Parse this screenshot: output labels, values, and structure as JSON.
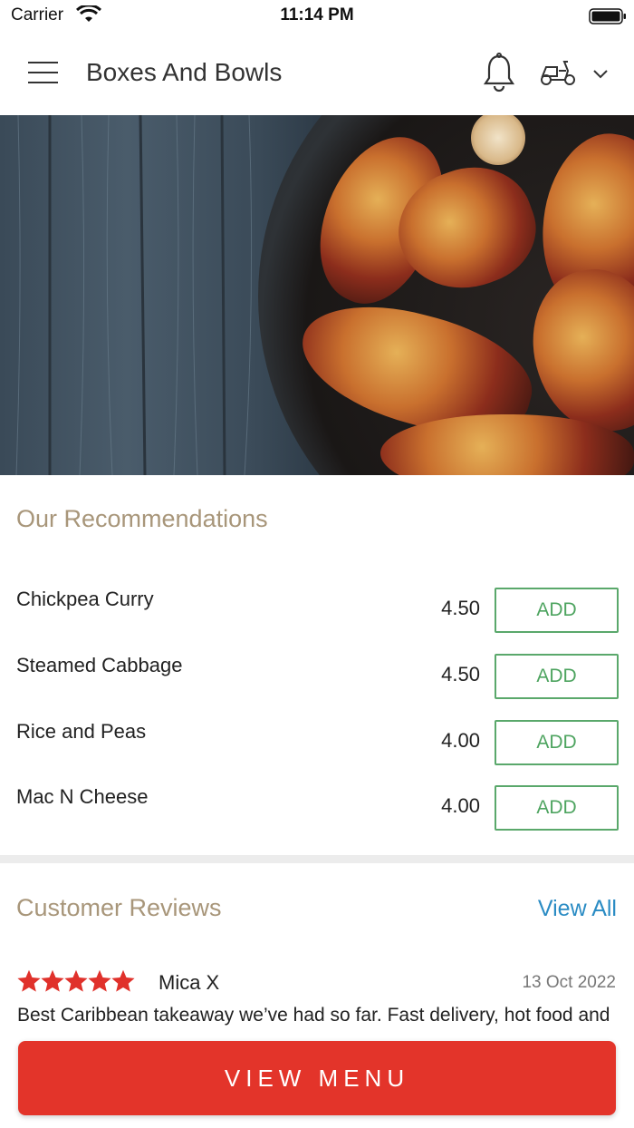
{
  "status_bar": {
    "carrier": "Carrier",
    "time": "11:14 PM"
  },
  "header": {
    "title": "Boxes And Bowls"
  },
  "recommendations": {
    "title": "Our Recommendations",
    "items": [
      {
        "name": "Chickpea Curry",
        "price": "4.50",
        "button": "ADD"
      },
      {
        "name": "Steamed Cabbage",
        "price": "4.50",
        "button": "ADD"
      },
      {
        "name": "Rice and Peas",
        "price": "4.00",
        "button": "ADD"
      },
      {
        "name": "Mac N Cheese",
        "price": "4.00",
        "button": "ADD"
      }
    ]
  },
  "reviews": {
    "title": "Customer Reviews",
    "view_all": "View All",
    "items": [
      {
        "rating": 5,
        "author": "Mica X",
        "date": "13 Oct 2022",
        "text": "Best Caribbean takeaway we’ve had so far. Fast delivery, hot food and"
      }
    ]
  },
  "footer": {
    "view_menu": "VIEW MENU"
  },
  "colors": {
    "accent_red": "#e3342a",
    "add_green": "#5aa86b",
    "section_title": "#a8967a",
    "link_blue": "#2b8cc4",
    "star_red": "#e0312b"
  }
}
